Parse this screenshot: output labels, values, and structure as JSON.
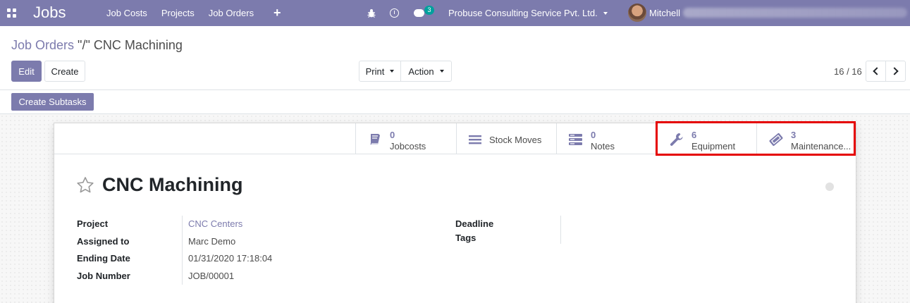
{
  "navbar": {
    "brand": "Jobs",
    "menu": [
      "Job Costs",
      "Projects",
      "Job Orders"
    ],
    "plus": "+",
    "chat_badge": "3",
    "company": "Probuse Consulting Service Pvt. Ltd.",
    "user": "Mitchell"
  },
  "breadcrumb": {
    "parent": "Job Orders",
    "separator": " \"/\" ",
    "current": "CNC Machining"
  },
  "toolbar": {
    "edit": "Edit",
    "create": "Create",
    "print": "Print",
    "action": "Action",
    "pager": "16 / 16"
  },
  "statusbar": {
    "create_subtasks": "Create Subtasks"
  },
  "smart_buttons": {
    "jobcosts": {
      "count": "0",
      "label": "Jobcosts"
    },
    "stock_moves": {
      "label": "Stock Moves"
    },
    "notes": {
      "count": "0",
      "label": "Notes"
    },
    "equipment": {
      "count": "6",
      "label": "Equipment"
    },
    "maintenance": {
      "count": "3",
      "label": "Maintenance..."
    }
  },
  "record": {
    "title": "CNC Machining"
  },
  "fields": {
    "project_label": "Project",
    "project_value": "CNC Centers",
    "assigned_label": "Assigned to",
    "assigned_value": "Marc Demo",
    "ending_label": "Ending Date",
    "ending_value": "01/31/2020 17:18:04",
    "jobnum_label": "Job Number",
    "jobnum_value": "JOB/00001",
    "deadline_label": "Deadline",
    "tags_label": "Tags"
  },
  "colors": {
    "brand": "#7c7bad",
    "highlight": "#e50000",
    "badge": "#00a09d"
  }
}
